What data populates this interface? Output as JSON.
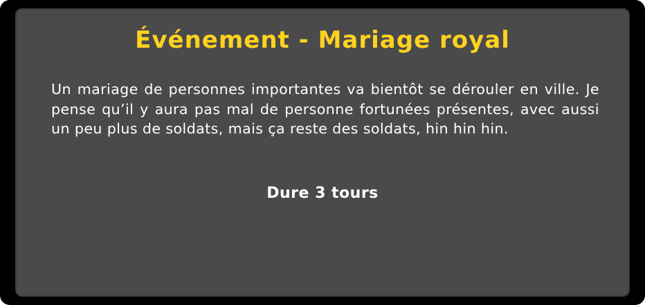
{
  "event_card": {
    "title": "Événement - Mariage royal",
    "description": "Un mariage de personnes importantes va bientôt se dérouler en ville. Je pense qu’il y aura pas mal de personne fortunées présentes, avec aussi un peu plus de soldats, mais ça reste des soldats, hin hin hin.",
    "duration": "Dure 3 tours"
  },
  "colors": {
    "title": "#ffd21f",
    "panel_background": "#4a4a4a",
    "border": "#000000",
    "text": "#ffffff"
  }
}
